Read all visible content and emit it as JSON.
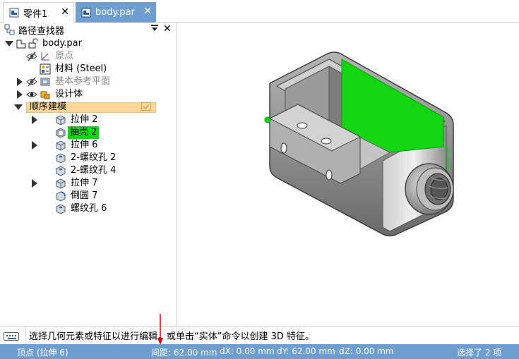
{
  "tabs": [
    {
      "label": "零件1",
      "close": "✕"
    },
    {
      "label": "body.par",
      "close": "✕"
    }
  ],
  "pathfinder": {
    "title": "路径查找器",
    "pin_icon": "pin-down-icon",
    "close": "✕"
  },
  "tree": {
    "root": "body.par",
    "origin": "原点",
    "material": "材料 (Steel)",
    "ref_planes": "基本参考平面",
    "design_body": "设计体",
    "sequential": "顺序建模",
    "features": [
      {
        "label": "拉伸 2",
        "expandable": true
      },
      {
        "label": "抽壳 2",
        "expandable": false,
        "selected": true
      },
      {
        "label": "拉伸 6",
        "expandable": true
      },
      {
        "label": "2-螺纹孔 2",
        "expandable": false
      },
      {
        "label": "2-螺纹孔 4",
        "expandable": false
      },
      {
        "label": "拉伸 7",
        "expandable": true
      },
      {
        "label": "倒圆 7",
        "expandable": false
      },
      {
        "label": "螺纹孔 6",
        "expandable": false
      }
    ]
  },
  "prompt": {
    "text": "选择几何元素或特征以进行编辑，或单击“实体”命令以创建 3D 特征。"
  },
  "status": {
    "vertex": "顶点 (拉伸 6)",
    "distance": "间距: 62.00 mm",
    "dx": "dX: 0.00 mm",
    "dy": "dY: 62.00 mm",
    "dz": "dZ: 0.00 mm",
    "selected": "选择了 2 项"
  },
  "colors": {
    "accent": "#6e9ed0",
    "selection_green": "#11d611",
    "sequential_bg": "#fbd89a"
  }
}
